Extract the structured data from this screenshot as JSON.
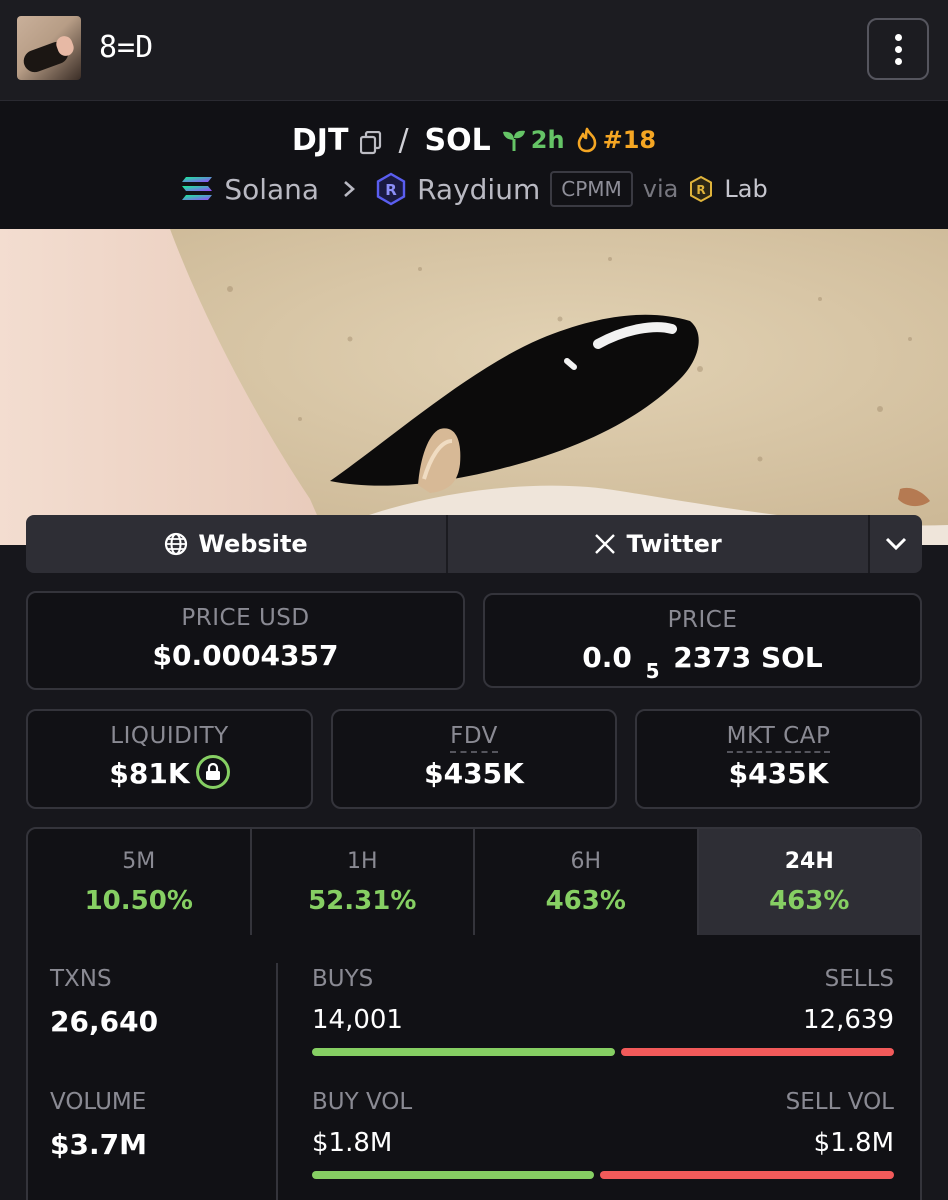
{
  "header": {
    "title": "8=D"
  },
  "pair": {
    "base": "DJT",
    "quote": "SOL",
    "age": "2h",
    "rank": "#18",
    "chain": "Solana",
    "dex": "Raydium",
    "pool_type": "CPMM",
    "via": "via",
    "launchpad": "Lab"
  },
  "links": {
    "website": "Website",
    "twitter": "Twitter"
  },
  "price": {
    "usd_label": "PRICE USD",
    "usd_value": "$0.0004357",
    "native_label": "PRICE",
    "native_prefix": "0.0",
    "native_zeros": "5",
    "native_digits": "2373",
    "native_unit": "SOL"
  },
  "metrics": {
    "liquidity_label": "LIQUIDITY",
    "liquidity_value": "$81K",
    "fdv_label": "FDV",
    "fdv_value": "$435K",
    "mcap_label": "MKT CAP",
    "mcap_value": "$435K"
  },
  "timeframes": [
    {
      "label": "5M",
      "change": "10.50%"
    },
    {
      "label": "1H",
      "change": "52.31%"
    },
    {
      "label": "6H",
      "change": "463%"
    },
    {
      "label": "24H",
      "change": "463%"
    }
  ],
  "active_timeframe": "24H",
  "stats": {
    "txns_label": "TXNS",
    "txns_value": "26,640",
    "buys_label": "BUYS",
    "buys_value": "14,001",
    "sells_label": "SELLS",
    "sells_value": "12,639",
    "volume_label": "VOLUME",
    "volume_value": "$3.7M",
    "buy_vol_label": "BUY VOL",
    "buy_vol_value": "$1.8M",
    "sell_vol_label": "SELL VOL",
    "sell_vol_value": "$1.8M",
    "buys_ratio": 0.5256,
    "buy_vol_ratio": 0.49
  },
  "colors": {
    "background": "#17171c",
    "positive": "#86cf63",
    "negative": "#f25a5a",
    "age_green": "#65c466",
    "rank_orange": "#f5a623"
  },
  "icons": [
    "menu-dots-icon",
    "copy-icon",
    "seedling-icon",
    "flame-icon",
    "solana-icon",
    "chevron-right-icon",
    "raydium-icon",
    "lab-icon",
    "globe-icon",
    "x-logo-icon",
    "chevron-down-icon",
    "lock-icon"
  ]
}
